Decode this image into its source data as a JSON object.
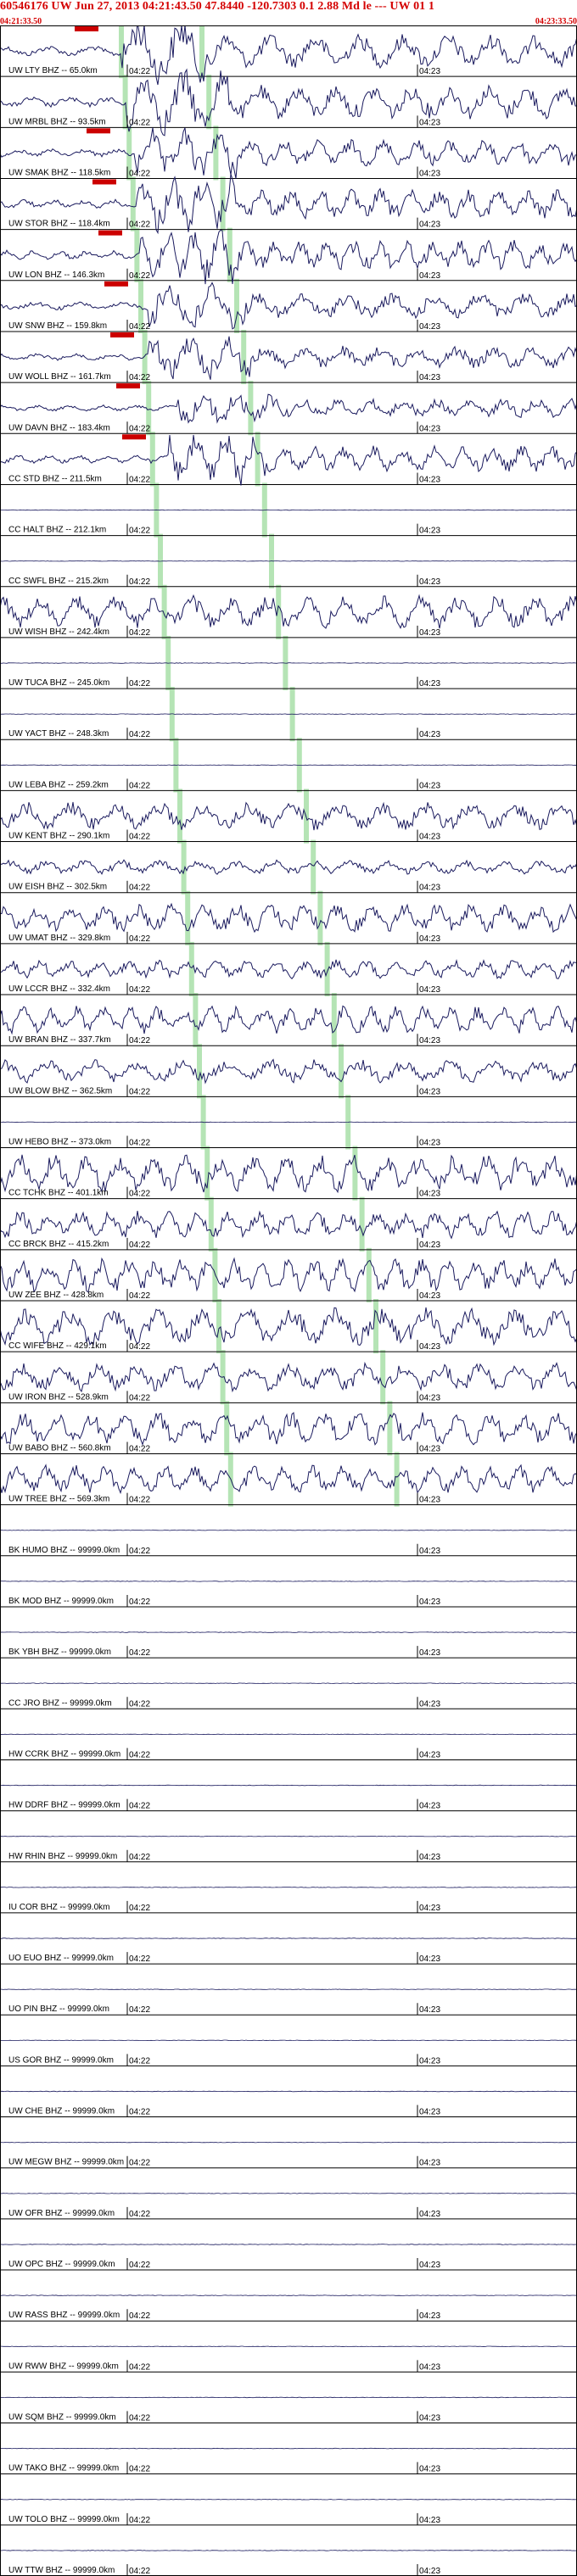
{
  "header": {
    "title": "60546176 UW Jun 27, 2013 04:21:43.50   47.8440 -120.7303  0.1 2.88 Md le --- UW 01   1",
    "start_time": "04:21:33.50",
    "end_time": "04:23:33.50"
  },
  "chart_data": {
    "type": "seismogram",
    "time_marks": [
      "04:22",
      "04:23"
    ],
    "colors": {
      "trace": "#1a1a5e",
      "pick": "#cc0000",
      "phase_marker": "#a8dfa8",
      "grid": "#000000",
      "header": "#d40000"
    },
    "traces": [
      {
        "label": "UW LTY BHZ -- 65.0km",
        "amp": 0.9,
        "event": 0.65,
        "quiet": false,
        "pick": true
      },
      {
        "label": "UW MRBL BHZ -- 93.5km",
        "amp": 0.9,
        "event": 0.68,
        "quiet": false,
        "pick": false
      },
      {
        "label": "UW SMAK BHZ -- 118.5km",
        "amp": 0.7,
        "event": 0.72,
        "quiet": false,
        "pick": true
      },
      {
        "label": "UW STOR BHZ -- 118.4km",
        "amp": 0.8,
        "event": 0.72,
        "quiet": false,
        "pick": true
      },
      {
        "label": "UW LON BHZ -- 146.3km",
        "amp": 0.8,
        "event": 0.75,
        "quiet": false,
        "pick": true
      },
      {
        "label": "UW SNW BHZ -- 159.8km",
        "amp": 0.7,
        "event": 0.8,
        "quiet": false,
        "pick": true
      },
      {
        "label": "UW WOLL BHZ -- 161.7km",
        "amp": 0.6,
        "event": 0.8,
        "quiet": false,
        "pick": true
      },
      {
        "label": "UW DAVN BHZ -- 183.4km",
        "amp": 0.5,
        "event": 0.95,
        "quiet": false,
        "pick": true
      },
      {
        "label": "CC STD BHZ -- 211.5km",
        "amp": 0.7,
        "event": 0.9,
        "quiet": false,
        "pick": true
      },
      {
        "label": "CC HALT BHZ -- 212.1km",
        "amp": 0.05,
        "event": 0,
        "quiet": true,
        "pick": false
      },
      {
        "label": "CC SWFL BHZ -- 215.2km",
        "amp": 0.0,
        "event": 0,
        "quiet": true,
        "pick": false
      },
      {
        "label": "UW WISH BHZ -- 242.4km",
        "amp": 0.7,
        "event": 0,
        "quiet": false,
        "pick": false
      },
      {
        "label": "UW TUCA BHZ -- 245.0km",
        "amp": 0.0,
        "event": 0,
        "quiet": true,
        "pick": false
      },
      {
        "label": "UW YACT BHZ -- 248.3km",
        "amp": 0.0,
        "event": 0,
        "quiet": true,
        "pick": false
      },
      {
        "label": "UW LEBA BHZ -- 259.2km",
        "amp": 0.0,
        "event": 0,
        "quiet": true,
        "pick": false
      },
      {
        "label": "UW KENT BHZ -- 290.1km",
        "amp": 0.6,
        "event": 0,
        "quiet": false,
        "pick": false
      },
      {
        "label": "UW EISH BHZ -- 302.5km",
        "amp": 0.3,
        "event": 0,
        "quiet": false,
        "pick": false
      },
      {
        "label": "UW UMAT BHZ -- 329.8km",
        "amp": 0.6,
        "event": 0,
        "quiet": false,
        "pick": false
      },
      {
        "label": "UW LCCR BHZ -- 332.4km",
        "amp": 0.4,
        "event": 0,
        "quiet": false,
        "pick": false
      },
      {
        "label": "UW BRAN BHZ -- 337.7km",
        "amp": 0.6,
        "event": 0,
        "quiet": false,
        "pick": false
      },
      {
        "label": "UW BLOW BHZ -- 362.5km",
        "amp": 0.5,
        "event": 0,
        "quiet": false,
        "pick": false
      },
      {
        "label": "UW HEBO BHZ -- 373.0km",
        "amp": 0.0,
        "event": 0,
        "quiet": true,
        "pick": false
      },
      {
        "label": "CC TCHK BHZ -- 401.1km",
        "amp": 0.8,
        "event": 0,
        "quiet": false,
        "pick": false
      },
      {
        "label": "CC BRCK BHZ -- 415.2km",
        "amp": 0.6,
        "event": 0,
        "quiet": false,
        "pick": false
      },
      {
        "label": "UW ZEE BHZ -- 428.8km",
        "amp": 0.7,
        "event": 0,
        "quiet": false,
        "pick": false
      },
      {
        "label": "CC WIFE BHZ -- 429.1km",
        "amp": 0.8,
        "event": 0,
        "quiet": false,
        "pick": false
      },
      {
        "label": "UW IRON BHZ -- 528.9km",
        "amp": 0.6,
        "event": 0,
        "quiet": false,
        "pick": false
      },
      {
        "label": "UW BABO BHZ -- 560.8km",
        "amp": 0.7,
        "event": 0,
        "quiet": false,
        "pick": false
      },
      {
        "label": "UW TREE BHZ -- 569.3km",
        "amp": 0.6,
        "event": 0,
        "quiet": false,
        "pick": false
      },
      {
        "label": "BK HUMO BHZ -- 99999.0km",
        "amp": 0,
        "event": 0,
        "quiet": true,
        "pick": false
      },
      {
        "label": "BK MOD BHZ -- 99999.0km",
        "amp": 0,
        "event": 0,
        "quiet": true,
        "pick": false
      },
      {
        "label": "BK YBH BHZ -- 99999.0km",
        "amp": 0,
        "event": 0,
        "quiet": true,
        "pick": false
      },
      {
        "label": "CC JRO BHZ -- 99999.0km",
        "amp": 0,
        "event": 0,
        "quiet": true,
        "pick": false
      },
      {
        "label": "HW CCRK BHZ -- 99999.0km",
        "amp": 0,
        "event": 0,
        "quiet": true,
        "pick": false
      },
      {
        "label": "HW DDRF BHZ -- 99999.0km",
        "amp": 0,
        "event": 0,
        "quiet": true,
        "pick": false
      },
      {
        "label": "HW RHIN BHZ -- 99999.0km",
        "amp": 0,
        "event": 0,
        "quiet": true,
        "pick": false
      },
      {
        "label": "IU COR BHZ -- 99999.0km",
        "amp": 0,
        "event": 0,
        "quiet": true,
        "pick": false
      },
      {
        "label": "UO EUO BHZ -- 99999.0km",
        "amp": 0,
        "event": 0,
        "quiet": true,
        "pick": false
      },
      {
        "label": "UO PIN BHZ -- 99999.0km",
        "amp": 0,
        "event": 0,
        "quiet": true,
        "pick": false
      },
      {
        "label": "US GOR BHZ -- 99999.0km",
        "amp": 0,
        "event": 0,
        "quiet": true,
        "pick": false
      },
      {
        "label": "UW CHE BHZ -- 99999.0km",
        "amp": 0,
        "event": 0,
        "quiet": true,
        "pick": false
      },
      {
        "label": "UW MEGW BHZ -- 99999.0km",
        "amp": 0,
        "event": 0,
        "quiet": true,
        "pick": false
      },
      {
        "label": "UW OFR BHZ -- 99999.0km",
        "amp": 0,
        "event": 0,
        "quiet": true,
        "pick": false
      },
      {
        "label": "UW OPC BHZ -- 99999.0km",
        "amp": 0,
        "event": 0,
        "quiet": true,
        "pick": false
      },
      {
        "label": "UW RASS BHZ -- 99999.0km",
        "amp": 0,
        "event": 0,
        "quiet": true,
        "pick": false
      },
      {
        "label": "UW RWW BHZ -- 99999.0km",
        "amp": 0,
        "event": 0,
        "quiet": true,
        "pick": false
      },
      {
        "label": "UW SQM BHZ -- 99999.0km",
        "amp": 0,
        "event": 0,
        "quiet": true,
        "pick": false
      },
      {
        "label": "UW TAKO BHZ -- 99999.0km",
        "amp": 0,
        "event": 0,
        "quiet": true,
        "pick": false
      },
      {
        "label": "UW TOLO BHZ -- 99999.0km",
        "amp": 0,
        "event": 0,
        "quiet": true,
        "pick": false
      },
      {
        "label": "UW TTW BHZ -- 99999.0km",
        "amp": 0,
        "event": 0,
        "quiet": true,
        "pick": false
      }
    ]
  }
}
